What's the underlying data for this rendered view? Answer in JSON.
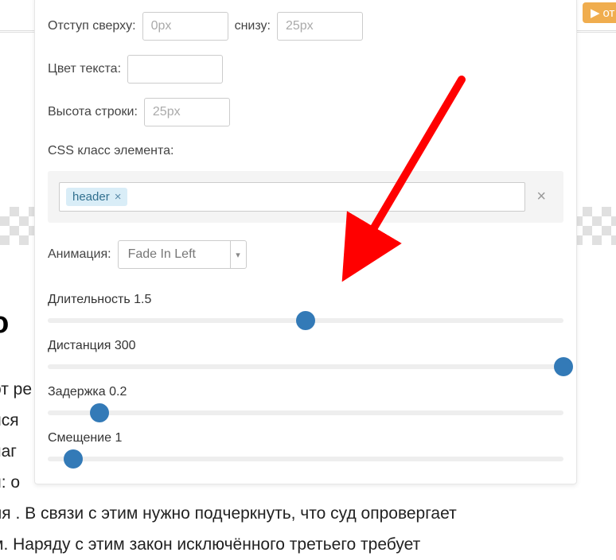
{
  "bg": {
    "title_fragment": "ово",
    "paragraph_lines": [
      "от ре",
      "йся",
      "наг",
      "и: о",
      "ля . В связи с этим нужно подчеркнуть, что суд опровергает",
      "м. Наряду с этим закон исключённого третьего требует"
    ]
  },
  "topbar": {
    "orange_fragment": "от"
  },
  "form": {
    "margin_top_label": "Отступ сверху:",
    "margin_top_placeholder": "0px",
    "margin_bottom_label": "снизу:",
    "margin_bottom_placeholder": "25px",
    "text_color_label": "Цвет текста:",
    "line_height_label": "Высота строки:",
    "line_height_placeholder": "25px",
    "css_class_label": "CSS класс элемента:",
    "tags": [
      {
        "text": "header"
      }
    ],
    "animation_label": "Анимация:",
    "animation_value": "Fade In Left"
  },
  "sliders": {
    "duration": {
      "label": "Длительность",
      "value": "1.5",
      "percent": 50
    },
    "distance": {
      "label": "Дистанция",
      "value": "300",
      "percent": 100
    },
    "delay": {
      "label": "Задержка",
      "value": "0.2",
      "percent": 10
    },
    "offset": {
      "label": "Смещение",
      "value": "1",
      "percent": 5
    }
  },
  "icons": {
    "play": "▶",
    "dropdown": "▾"
  },
  "colors": {
    "accent": "#337ab7",
    "arrow": "#ff0000"
  }
}
